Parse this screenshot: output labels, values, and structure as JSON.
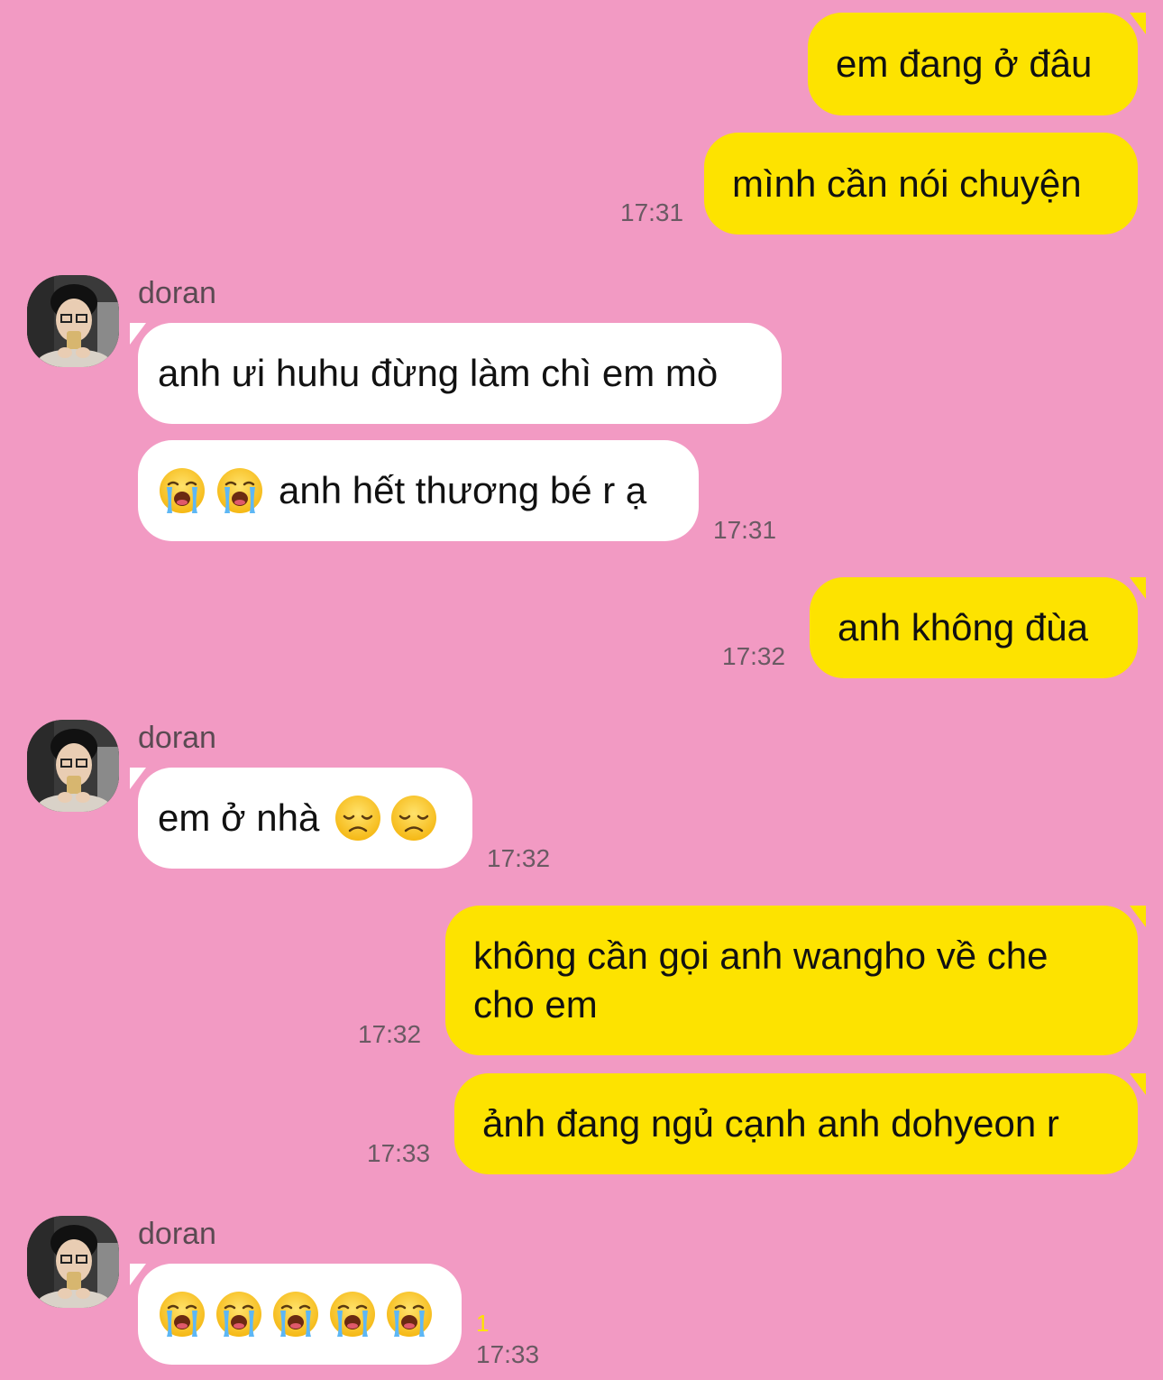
{
  "chat": {
    "contact_name": "doran",
    "messages": [
      {
        "side": "out",
        "text": "em đang ở đâu"
      },
      {
        "side": "out",
        "text": "mình cần nói chuyện",
        "time": "17:31"
      },
      {
        "side": "in",
        "sender": "doran",
        "text": "anh ưi huhu đừng làm chì em mò"
      },
      {
        "side": "in",
        "emoji": [
          "loudly-crying-face",
          "loudly-crying-face"
        ],
        "text": "anh hết thương bé r ạ",
        "time": "17:31"
      },
      {
        "side": "out",
        "text": "anh không đùa",
        "time": "17:32"
      },
      {
        "side": "in",
        "sender": "doran",
        "text": "em ở nhà",
        "emoji": [
          "disappointed-face",
          "disappointed-face"
        ],
        "time": "17:32"
      },
      {
        "side": "out",
        "text": "không cần gọi anh wangho về che cho em",
        "time": "17:32"
      },
      {
        "side": "out",
        "text": "ảnh đang ngủ cạnh anh dohyeon r",
        "time": "17:33"
      },
      {
        "side": "in",
        "sender": "doran",
        "emoji": [
          "loudly-crying-face",
          "loudly-crying-face",
          "loudly-crying-face",
          "loudly-crying-face",
          "loudly-crying-face"
        ],
        "unread": "1",
        "time": "17:33"
      }
    ]
  },
  "colors": {
    "background": "#f29ac3",
    "outgoing_bubble": "#fde300",
    "incoming_bubble": "#ffffff"
  }
}
